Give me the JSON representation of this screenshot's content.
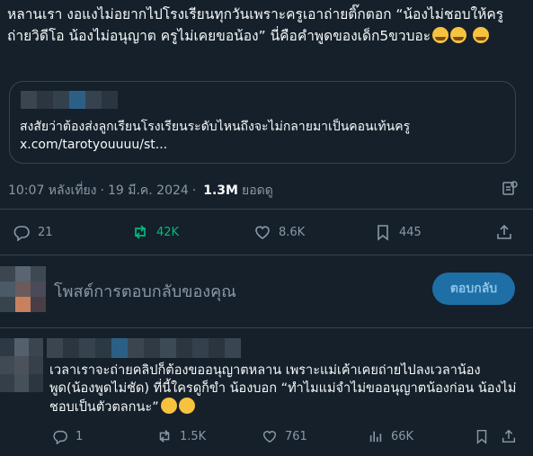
{
  "tweet": {
    "text": "หลานเรา งอแงไม่อยากไปโรงเรียนทุกวันเพราะครูเอาถ่ายติ๊กตอก “น้องไม่ชอบให้ครูถ่ายวิดีโอ น้องไม่อนุญาต ครูไม่เคยขอน้อง” นี่คือคำพูดของเด็ก5ขวบอะ",
    "emojis": [
      "loudly-crying-face-emoji",
      "loudly-crying-face-emoji",
      "loudly-crying-face-emoji"
    ]
  },
  "quote": {
    "text": "สงสัยว่าต้องส่งลูกเรียนโรงเรียนระดับไหนถึงจะไม่กลายมาเป็นคอนเท้นครู",
    "link": "x.com/tarotyouuuu/st..."
  },
  "meta": {
    "time": "10:07 หลังเที่ยง",
    "separator": "·",
    "date": "19 มี.ค. 2024",
    "separator2": "·",
    "views_count": "1.3M",
    "views_label": "ยอดดู"
  },
  "actions": {
    "replies": "21",
    "reposts": "42K",
    "likes": "8.6K",
    "bookmarks": "445"
  },
  "reply_box": {
    "placeholder": "โพสต์การตอบกลับของคุณ",
    "button": "ตอบกลับ"
  },
  "reply_tweet": {
    "text": "เวลาเราจะถ่ายคลิปก็ต้องขออนุญาตหลาน เพราะแม่เค้าเคยถ่ายไปลงเวลาน้องพูด(น้องพูดไม่ชัด) ที่นี้ใครดูก็ขำ น้องบอก “ทำไมแม่จำไม่ขออนุญาตน้องก่อน น้องไม่ชอบเป็นตัวตลกนะ”",
    "replies": "1",
    "reposts": "1.5K",
    "likes": "761",
    "views": "66K"
  },
  "colors": {
    "background": "#15202b",
    "text": "#f7f9f9",
    "muted": "#8b98a5",
    "repost_active": "#00ba7c",
    "border": "#38444d",
    "button": "#1d6fa5"
  }
}
